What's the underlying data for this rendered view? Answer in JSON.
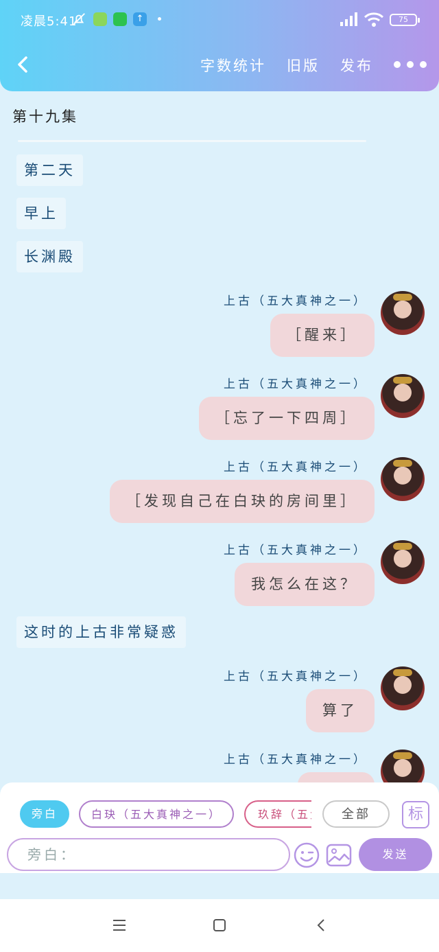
{
  "status": {
    "time": "凌晨5:41",
    "battery": "75"
  },
  "nav": {
    "stats": "字数统计",
    "old": "旧版",
    "publish": "发布"
  },
  "episode": "第十九集",
  "narrations": [
    "第二天",
    "早上",
    "长渊殿",
    "这时的上古非常疑惑"
  ],
  "speaker": "上古（五大真神之一）",
  "messages": [
    "［醒来］",
    "［忘了一下四周］",
    "［发现自己在白玦的房间里］",
    "我怎么在这？",
    "算了",
    ""
  ],
  "chips": {
    "narr": "旁白",
    "bk": "白玦（五大真神之一）",
    "jc": "玖辞（五大真神之一）",
    "all": "全部",
    "biao": "标"
  },
  "input": {
    "placeholder": "旁白："
  },
  "send": "发送",
  "colors": {
    "accent": "#b190e2",
    "header_start": "#5fd3f7",
    "header_end": "#b497ea",
    "bubble": "#f1d7da"
  }
}
